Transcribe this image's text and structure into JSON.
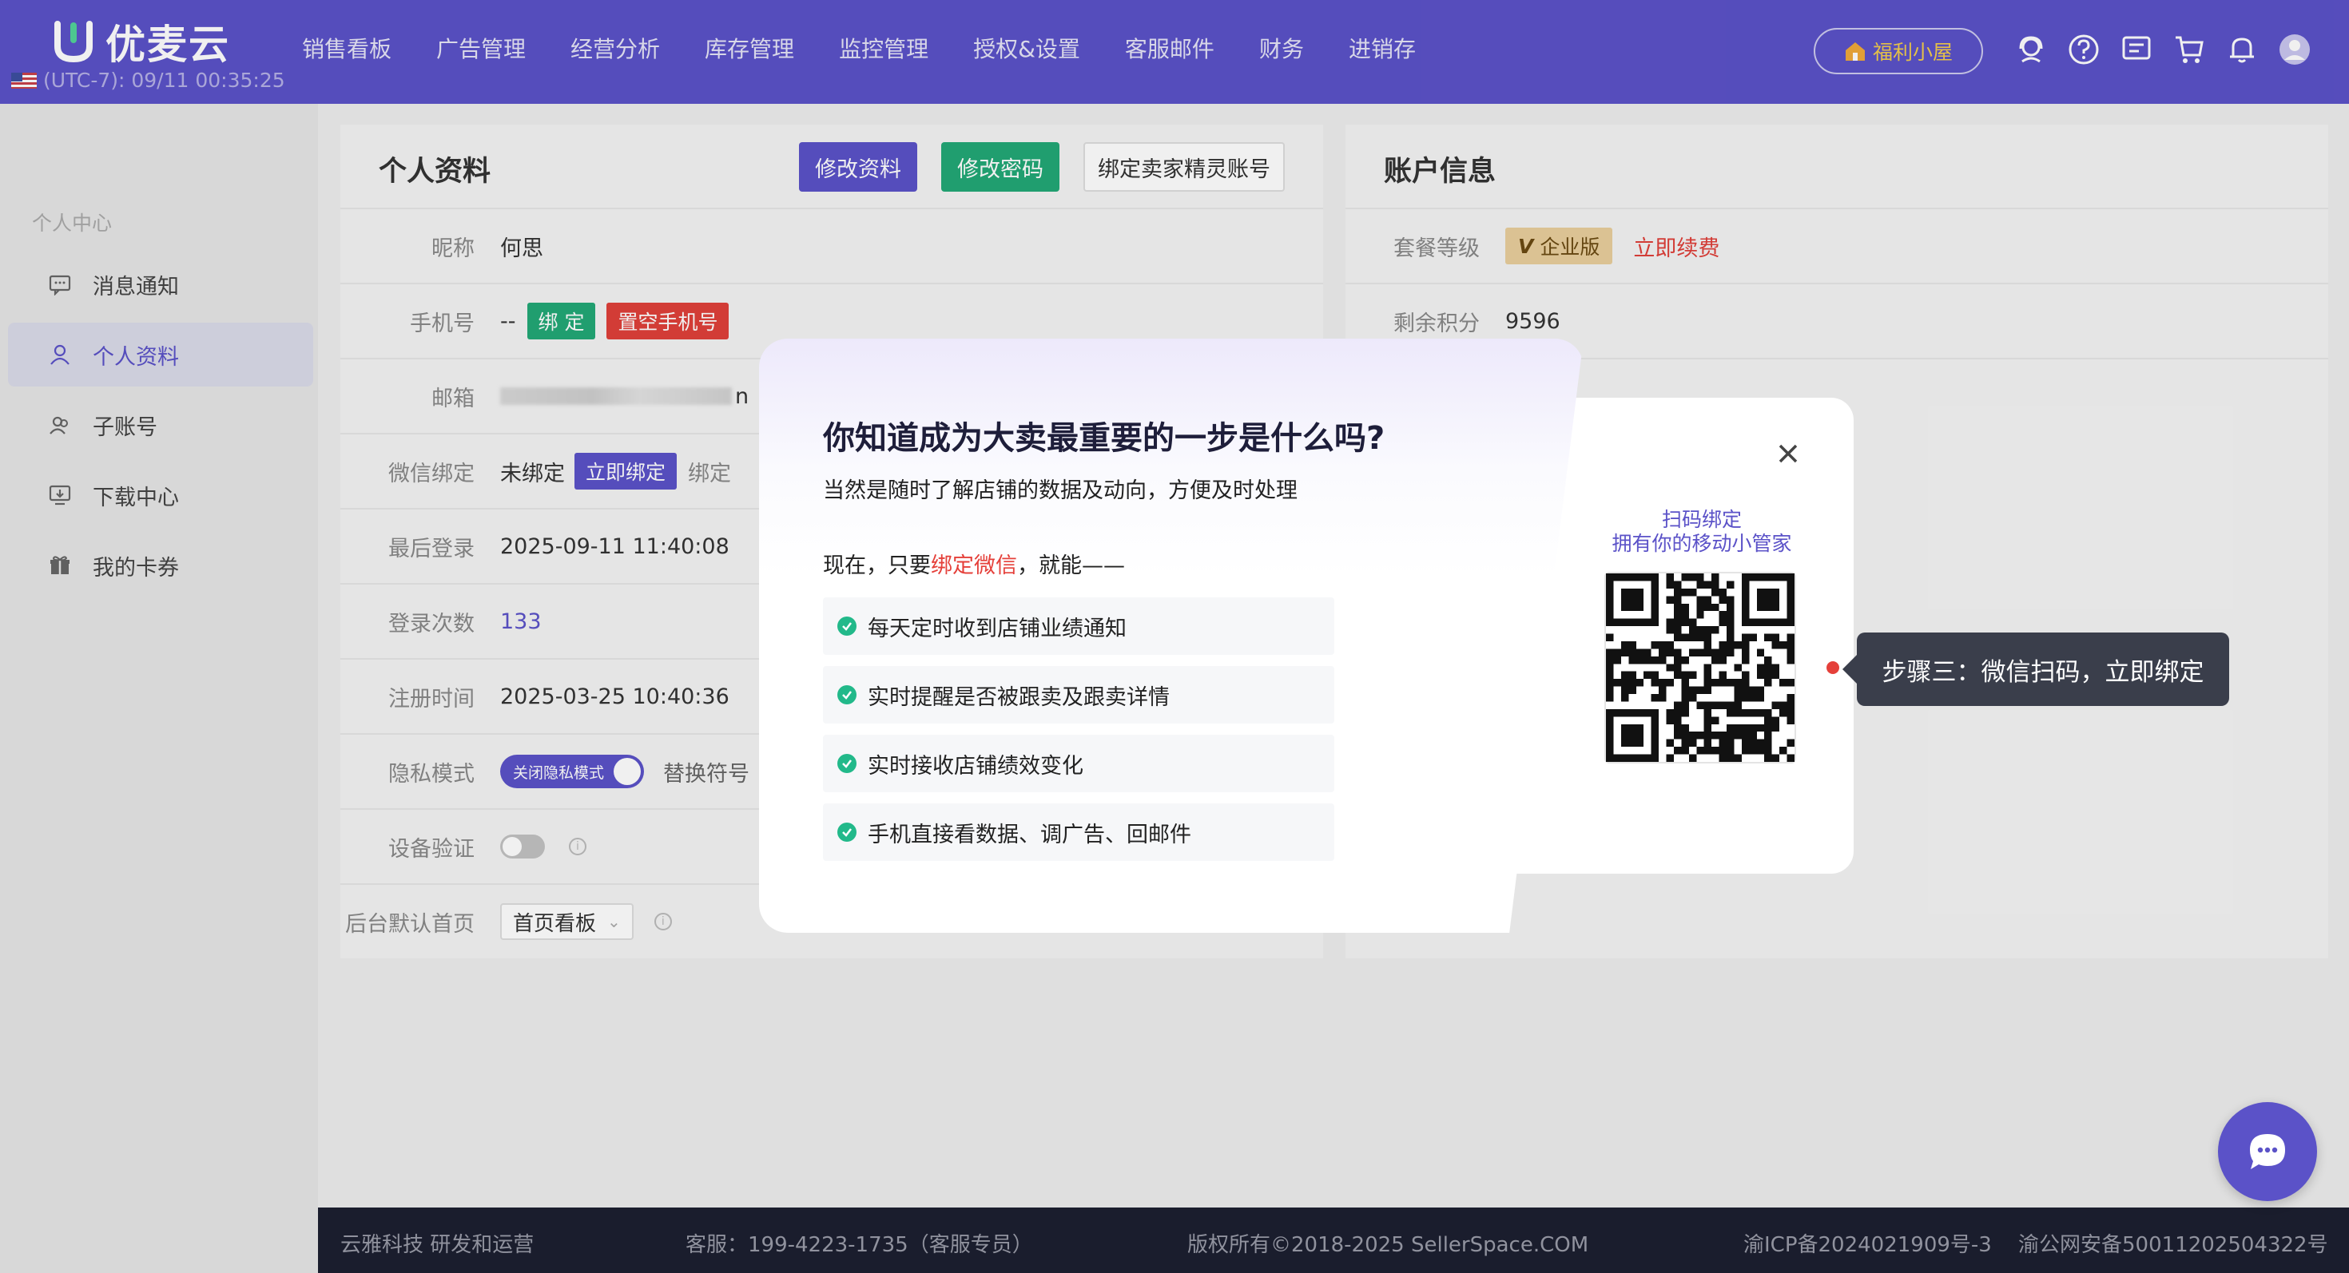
{
  "app": {
    "name": "优麦云",
    "clock": "(UTC-7): 09/11 00:35:25"
  },
  "nav": {
    "menu": [
      "销售看板",
      "广告管理",
      "经营分析",
      "库存管理",
      "监控管理",
      "授权&设置",
      "客服邮件",
      "财务",
      "进销存"
    ],
    "welfare": "福利小屋",
    "icons": [
      "support-icon",
      "help-icon",
      "message-icon",
      "cart-icon",
      "bell-icon",
      "avatar"
    ]
  },
  "sidebar": {
    "title": "个人中心",
    "items": [
      {
        "label": "消息通知",
        "icon": "chat-icon"
      },
      {
        "label": "个人资料",
        "icon": "user-icon",
        "active": true
      },
      {
        "label": "子账号",
        "icon": "sub-account-icon"
      },
      {
        "label": "下载中心",
        "icon": "download-icon"
      },
      {
        "label": "我的卡券",
        "icon": "gift-icon"
      }
    ]
  },
  "profile": {
    "title": "个人资料",
    "buttons": {
      "edit": "修改资料",
      "password": "修改密码",
      "bind_seller": "绑定卖家精灵账号"
    },
    "rows": {
      "nickname": {
        "label": "昵称",
        "value": "何思"
      },
      "phone": {
        "label": "手机号",
        "value": "--",
        "bind": "绑 定",
        "clear": "置空手机号"
      },
      "email": {
        "label": "邮箱",
        "value_tail": "n"
      },
      "wechat": {
        "label": "微信绑定",
        "value": "未绑定",
        "bind_now": "立即绑定",
        "extra": "绑定"
      },
      "last_login": {
        "label": "最后登录",
        "value": "2025-09-11 11:40:08"
      },
      "login_count": {
        "label": "登录次数",
        "value": "133"
      },
      "register_time": {
        "label": "注册时间",
        "value": "2025-03-25 10:40:36"
      },
      "privacy": {
        "label": "隐私模式",
        "toggle": "关闭隐私模式",
        "extra": "替换符号"
      },
      "device_verify": {
        "label": "设备验证"
      },
      "default_home": {
        "label": "后台默认首页",
        "value": "首页看板"
      }
    }
  },
  "account": {
    "title": "账户信息",
    "plan": {
      "label": "套餐等级",
      "badge": "企业版",
      "renew": "立即续费"
    },
    "points": {
      "label": "剩余积分",
      "value": "9596"
    }
  },
  "popup": {
    "title": "你知道成为大卖最重要的一步是什么吗?",
    "subtitle": "当然是随时了解店铺的数据及动向，方便及时处理",
    "now_prefix": "现在，只要",
    "now_highlight": "绑定微信",
    "now_suffix": "，就能——",
    "features": [
      "每天定时收到店铺业绩通知",
      "实时提醒是否被跟卖及跟卖详情",
      "实时接收店铺绩效变化",
      "手机直接看数据、调广告、回邮件"
    ],
    "qr_title_1": "扫码绑定",
    "qr_title_2": "拥有你的移动小管家",
    "step_tip": "步骤三：微信扫码，立即绑定"
  },
  "footer": {
    "company": "云雅科技 研发和运营",
    "service": "客服：199-4223-1735（客服专员）",
    "copyright": "版权所有©2018-2025 SellerSpace.COM",
    "icp": "渝ICP备2024021909号-3",
    "police": "渝公网安备50011202504322号"
  },
  "colors": {
    "brand": "#5b52c8",
    "green": "#22a876",
    "red": "#e0403a",
    "gold": "#e9cf9d"
  }
}
